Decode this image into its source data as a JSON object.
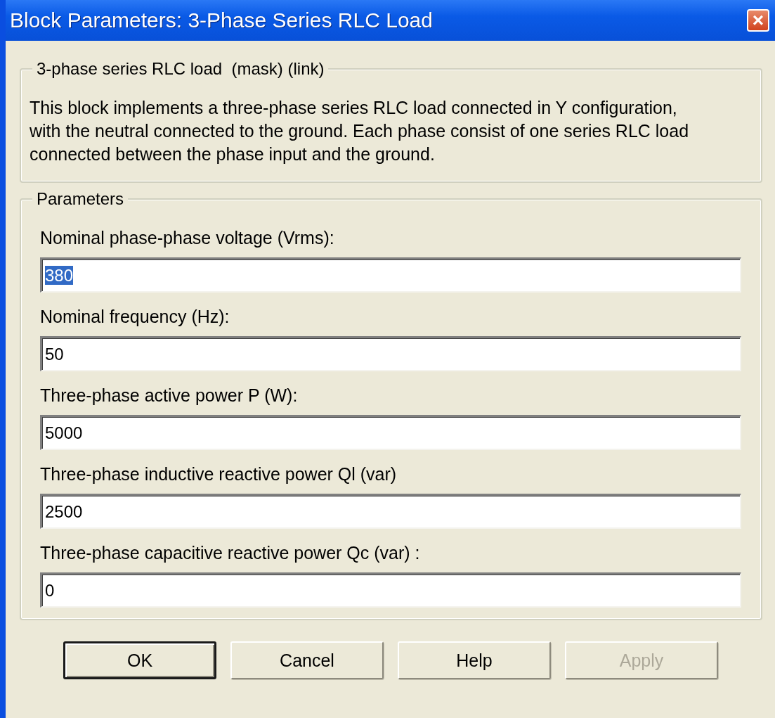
{
  "window": {
    "title": "Block Parameters: 3-Phase Series RLC Load",
    "close": "×"
  },
  "description_group": {
    "legend": "3-phase series RLC load  (mask) (link)",
    "text": "This block implements a three-phase series RLC load connected in Y configuration, with the neutral connected to the ground.  Each phase consist of one series RLC load connected between the phase input and the ground."
  },
  "parameters": {
    "legend": "Parameters",
    "fields": [
      {
        "label": "Nominal phase-phase voltage (Vrms):",
        "value": "380",
        "selected": true
      },
      {
        "label": "Nominal frequency (Hz):",
        "value": "50",
        "selected": false
      },
      {
        "label": "Three-phase active power P (W):",
        "value": "5000",
        "selected": false
      },
      {
        "label": "Three-phase inductive reactive power Ql (var)",
        "value": "2500",
        "selected": false
      },
      {
        "label": "Three-phase capacitive reactive power Qc (var) :",
        "value": "0",
        "selected": false
      }
    ]
  },
  "buttons": [
    {
      "label": "OK",
      "default": true,
      "disabled": false
    },
    {
      "label": "Cancel",
      "default": false,
      "disabled": false
    },
    {
      "label": "Help",
      "default": false,
      "disabled": false
    },
    {
      "label": "Apply",
      "default": false,
      "disabled": true
    }
  ]
}
